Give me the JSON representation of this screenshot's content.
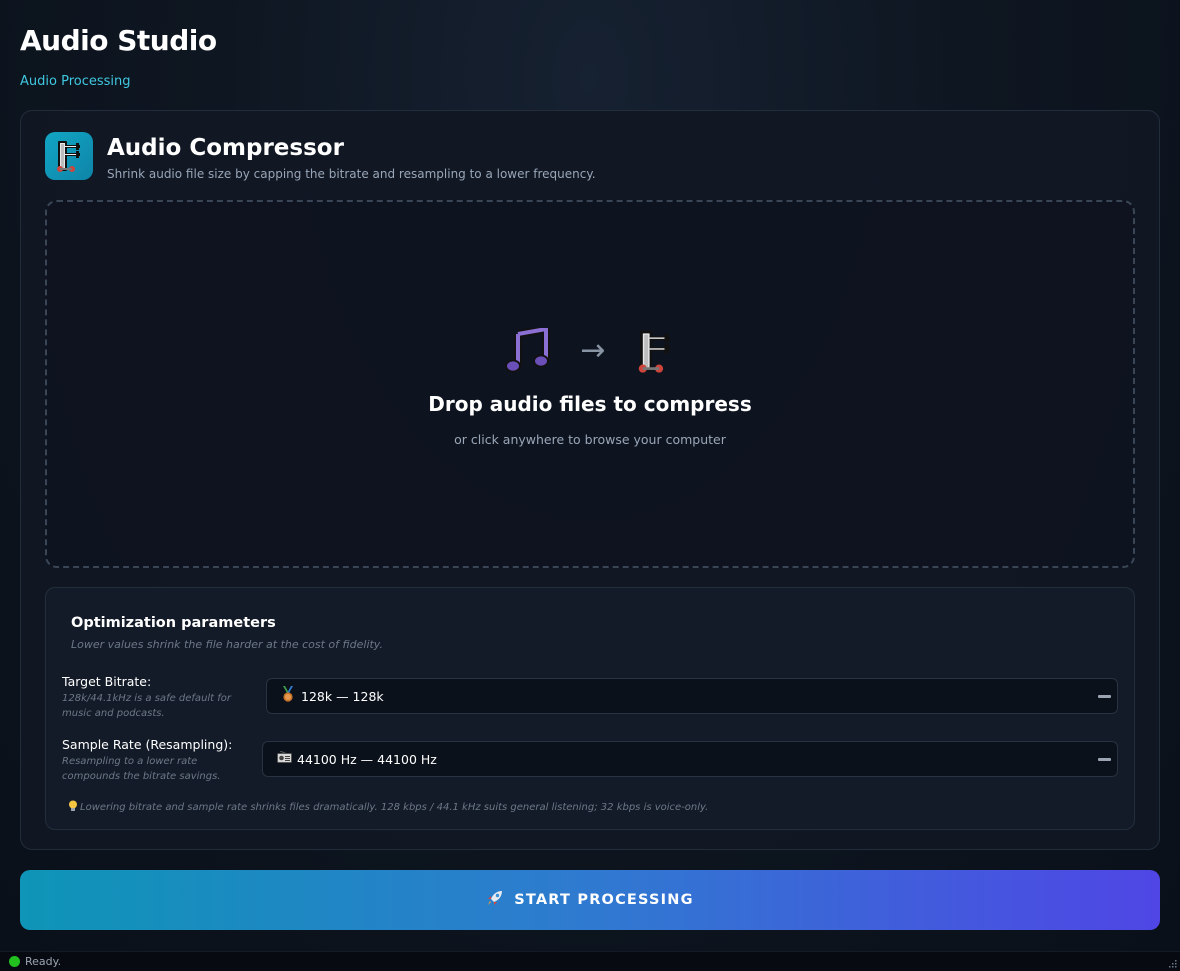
{
  "app": {
    "title": "Audio Studio",
    "subtitle": "Audio Processing"
  },
  "tool": {
    "icon": "clamp-icon",
    "title": "Audio Compressor",
    "description": "Shrink audio file size by capping the bitrate and resampling to a lower frequency."
  },
  "dropzone": {
    "icons": [
      "music-notes-icon",
      "arrow-right-icon",
      "clamp-icon"
    ],
    "arrow": "→",
    "title": "Drop audio files to compress",
    "hint": "or click anywhere to browse your computer"
  },
  "params": {
    "title": "Optimization parameters",
    "subtitle": "Lower values shrink the file harder at the cost of fidelity.",
    "bitrate": {
      "label": "Target Bitrate:",
      "help": "128k/44.1kHz is a safe default for music and podcasts.",
      "icon": "medal-icon",
      "selected": "128k — 128k"
    },
    "sample_rate": {
      "label": "Sample Rate (Resampling):",
      "help": "Resampling to a lower rate compounds the bitrate savings.",
      "icon": "radio-icon",
      "selected": "44100 Hz — 44100 Hz"
    },
    "note_icon": "lightbulb-icon",
    "note": "Lowering bitrate and sample rate shrinks files dramatically. 128 kbps / 44.1 kHz suits general listening; 32 kbps is voice-only."
  },
  "start_button": {
    "icon": "rocket-icon",
    "label": "START PROCESSING"
  },
  "status": {
    "text": "Ready.",
    "color": "#22c11f"
  },
  "colors": {
    "accent": "#3fc8e0",
    "gradient_start": "#0e95b7",
    "gradient_end": "#4f46e5"
  }
}
